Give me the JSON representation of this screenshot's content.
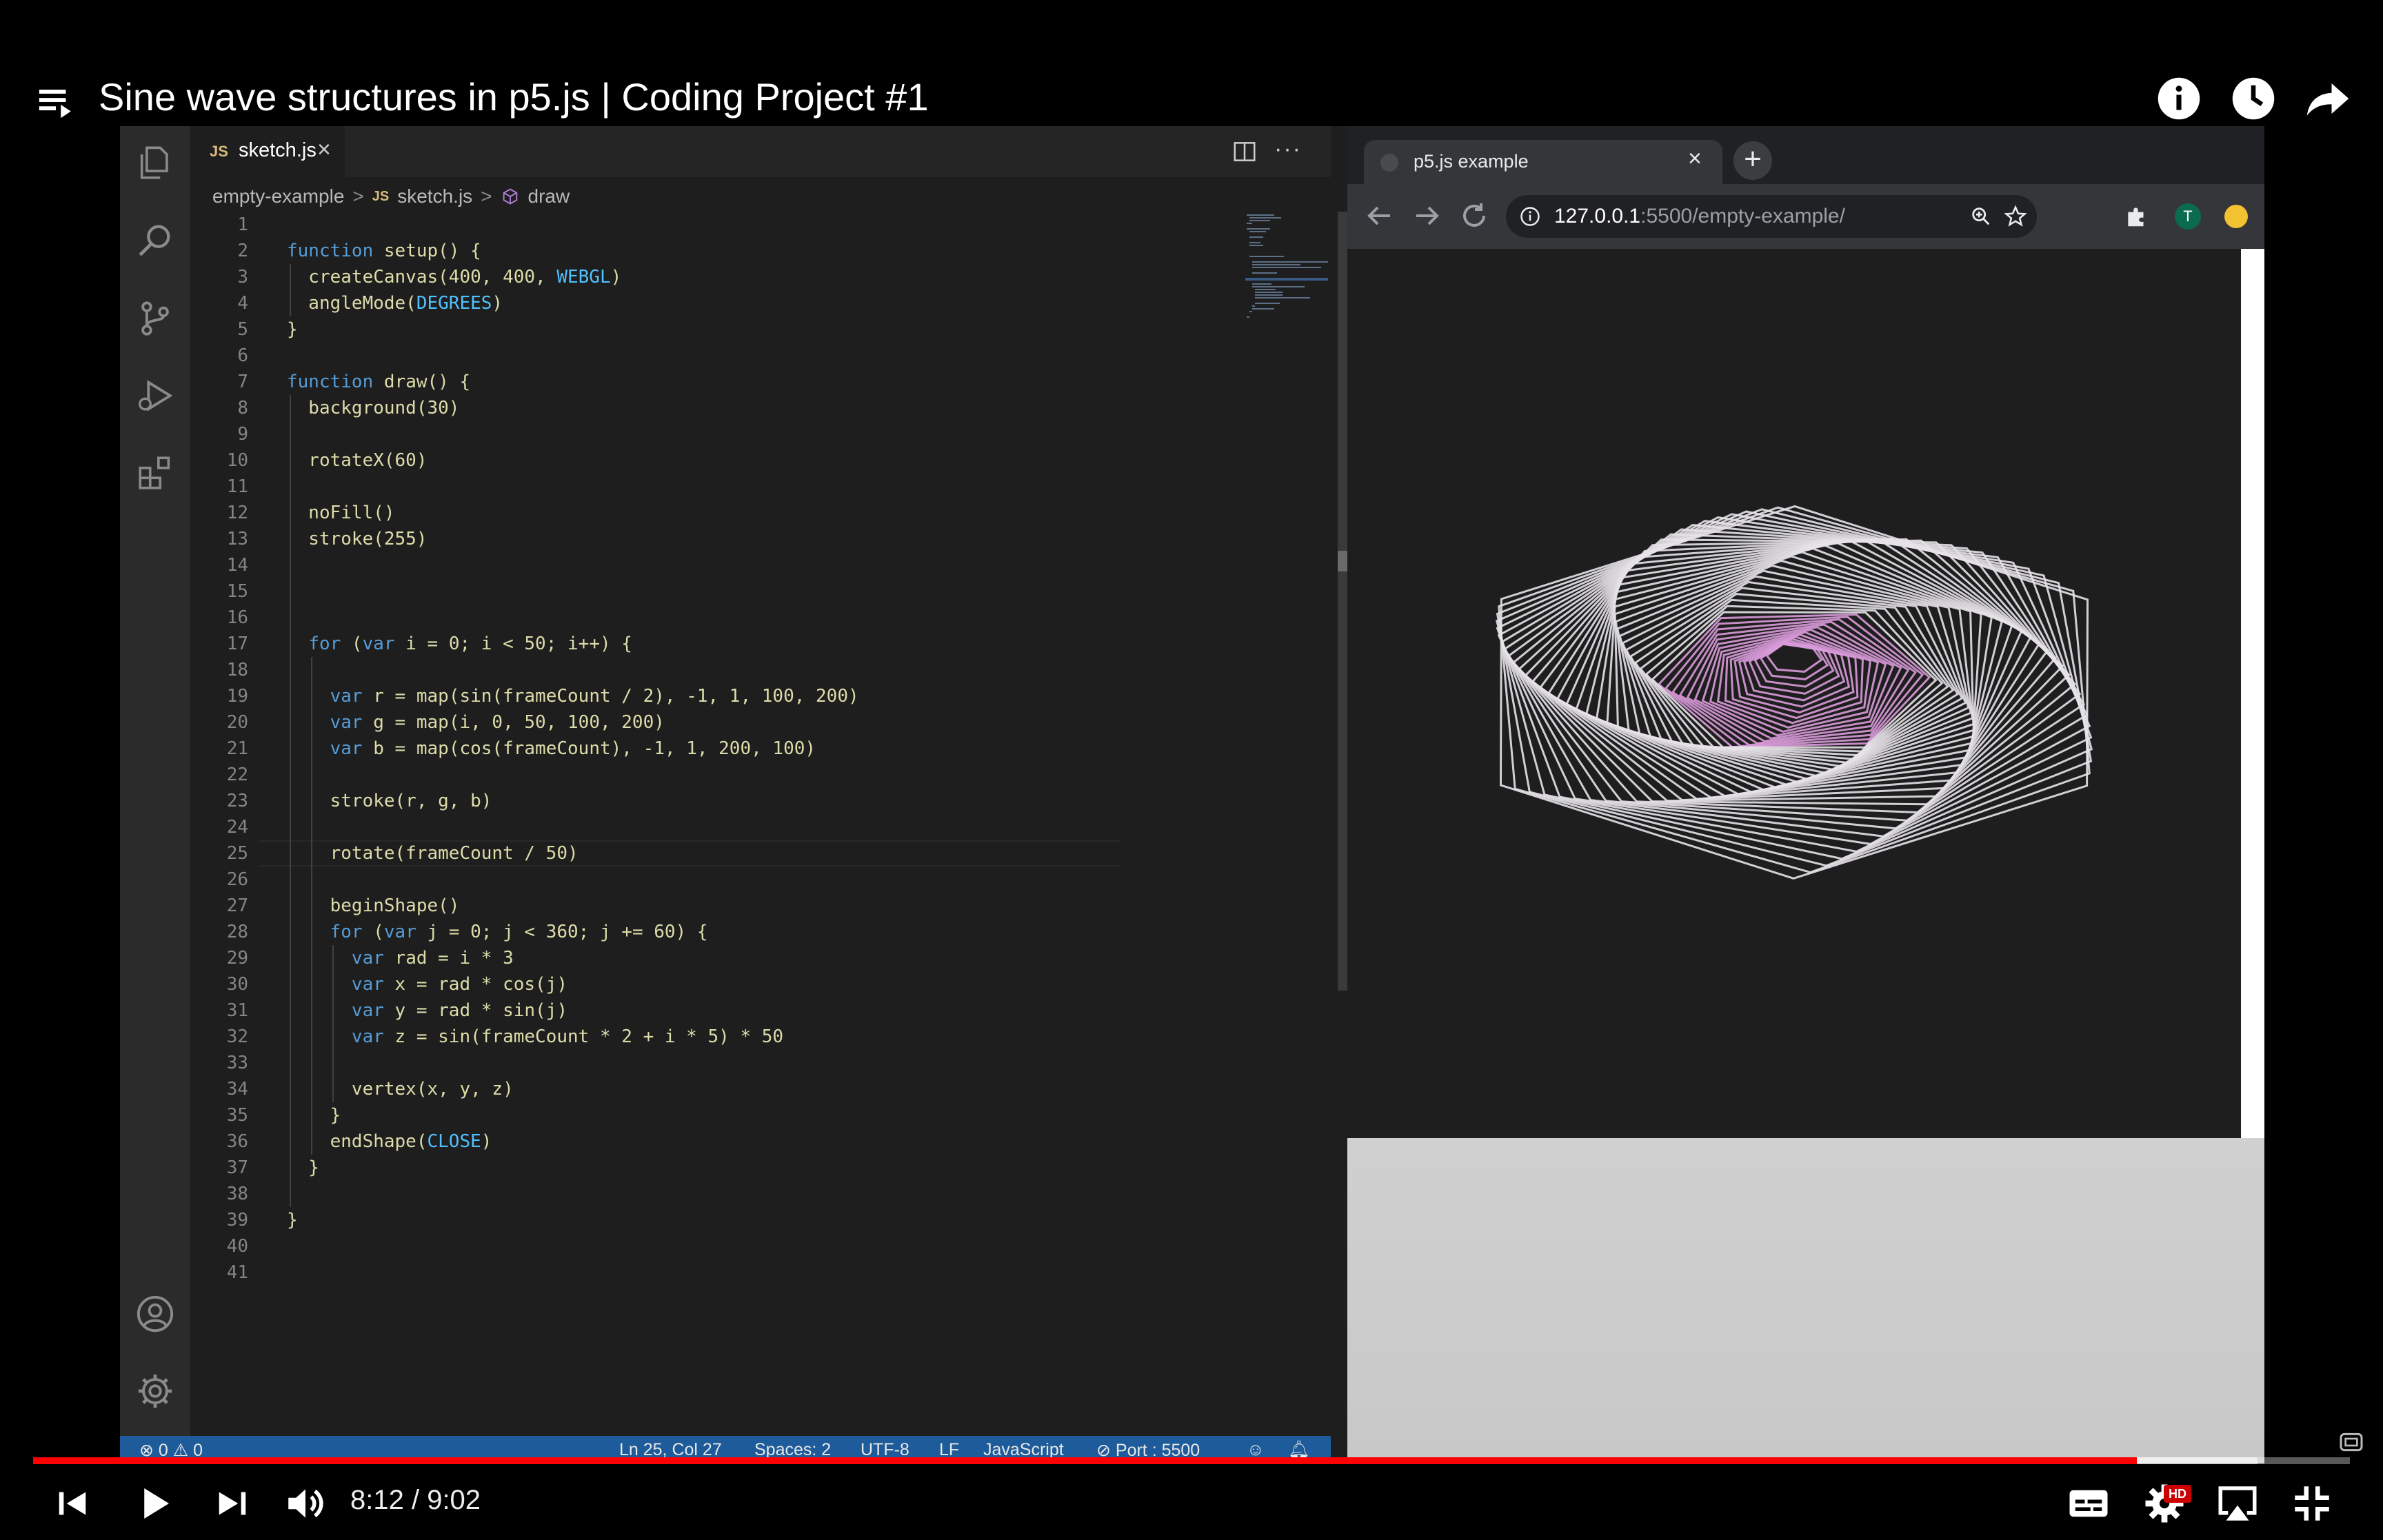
{
  "video": {
    "title": "Sine wave structures in p5.js | Coding Project #1",
    "time_current": "8:12",
    "time_total": "9:02",
    "time_display": "8:12 / 9:02",
    "progress_fraction": 0.908,
    "buffered_fraction": 0.96,
    "hd_label": "HD",
    "colors": {
      "progress": "#ff0000",
      "background": "#000000"
    }
  },
  "top_icons": [
    "playlist-icon",
    "info-icon",
    "watch-later-icon",
    "share-icon"
  ],
  "vscode": {
    "tab": {
      "lang": "JS",
      "label": "sketch.js"
    },
    "breadcrumb": {
      "folder": "empty-example",
      "file_lang": "JS",
      "file": "sketch.js",
      "symbol": "draw"
    },
    "code_lines": [
      "",
      "function setup() {",
      "  createCanvas(400, 400, WEBGL)",
      "  angleMode(DEGREES)",
      "}",
      "",
      "function draw() {",
      "  background(30)",
      "",
      "  rotateX(60)",
      "",
      "  noFill()",
      "  stroke(255)",
      "",
      "",
      "",
      "  for (var i = 0; i < 50; i++) {",
      "",
      "    var r = map(sin(frameCount / 2), -1, 1, 100, 200)",
      "    var g = map(i, 0, 50, 100, 200)",
      "    var b = map(cos(frameCount), -1, 1, 200, 100)",
      "",
      "    stroke(r, g, b)",
      "",
      "    rotate(frameCount / 50)",
      "",
      "    beginShape()",
      "    for (var j = 0; j < 360; j += 60) {",
      "      var rad = i * 3",
      "      var x = rad * cos(j)",
      "      var y = rad * sin(j)",
      "      var z = sin(frameCount * 2 + i * 5) * 50",
      "",
      "      vertex(x, y, z)",
      "    }",
      "    endShape(CLOSE)",
      "  }",
      "",
      "}",
      "",
      ""
    ],
    "cursor_line": 25,
    "status": {
      "errors": "0",
      "warnings": "0",
      "position": "Ln 25, Col 27",
      "spaces": "Spaces: 2",
      "encoding": "UTF-8",
      "eol": "LF",
      "language": "JavaScript",
      "port": "Port : 5500"
    },
    "colors": {
      "keyword": "#569cd6",
      "function": "#dcdcaa",
      "constant": "#4fc1ff",
      "statusbar": "#1e5b9a"
    }
  },
  "browser": {
    "tab_title": "p5.js example",
    "url_host": "127.0.0.1",
    "url_rest": ":5500/empty-example/",
    "profile_initial": "T",
    "sketch_colors": {
      "canvas": "#1e1e1e",
      "stroke_light": "#e6e2e8",
      "stroke_pink": "#d89ad8"
    }
  }
}
